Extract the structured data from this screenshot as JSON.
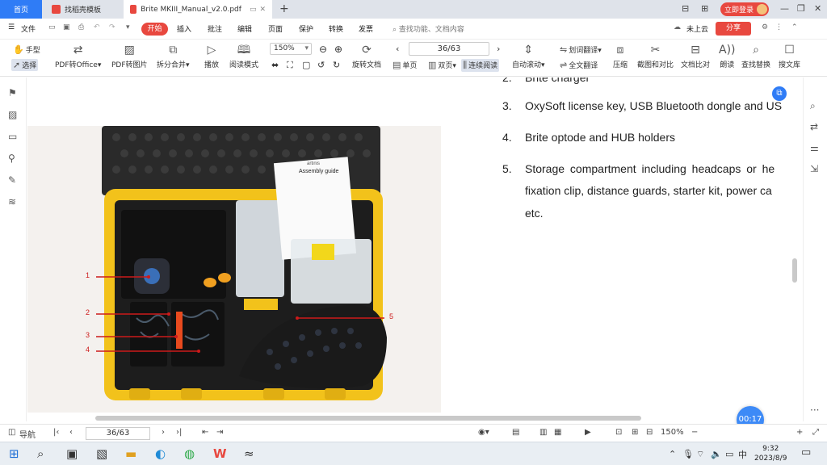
{
  "tabs": [
    {
      "label": "首页"
    },
    {
      "label": "找稻壳模板"
    },
    {
      "label": "Brite MKIII_Manual_v2.0.pdf"
    }
  ],
  "login_label": "立即登录",
  "menu": [
    "文件",
    "开始",
    "插入",
    "批注",
    "编辑",
    "页面",
    "保护",
    "转换",
    "发票"
  ],
  "search_placeholder": "查找功能、文档内容",
  "cloud_label": "未上云",
  "share_label": "分享",
  "toolbar": {
    "hand": "手型",
    "select": "选择",
    "pdf_office": "PDF转Office",
    "pdf_img": "PDF转图片",
    "split": "拆分合并",
    "play": "播放",
    "read_mode": "阅读模式",
    "zoom": "150%",
    "page": "36/63",
    "rotate": "旋转文档",
    "single": "单页",
    "double": "双页",
    "continuous": "连续阅读",
    "auto_scroll": "自动滚动",
    "word_translate": "划词翻译",
    "full_translate": "全文翻译",
    "compress": "压缩",
    "screenshot": "截图和对比",
    "doc_compare": "文档比对",
    "read_aloud": "朗读",
    "find_replace": "查找替换",
    "search_lib": "搜文库"
  },
  "doc": {
    "items": [
      {
        "num": "2.",
        "text": "Brite charger"
      },
      {
        "num": "3.",
        "text": "OxySoft license key, USB Bluetooth dongle and US"
      },
      {
        "num": "4.",
        "text": "Brite optode and HUB holders"
      },
      {
        "num": "5.",
        "text": "Storage compartment including headcaps or he"
      }
    ],
    "cont1": "fixation clip, distance guards, starter kit, power ca",
    "cont2": "etc.",
    "callouts": [
      "1",
      "2",
      "3",
      "4",
      "5"
    ],
    "guide_title": "Assembly guide",
    "artinis": "artinis"
  },
  "status": {
    "nav": "导航",
    "page": "36/63",
    "zoom": "150%"
  },
  "timer": "00:17",
  "clock": {
    "time": "9:32",
    "date": "2023/8/9"
  },
  "ime": "中",
  "colors": {
    "accent": "#2f7cf6",
    "red": "#e8483f",
    "case_yellow": "#f2c21b"
  }
}
